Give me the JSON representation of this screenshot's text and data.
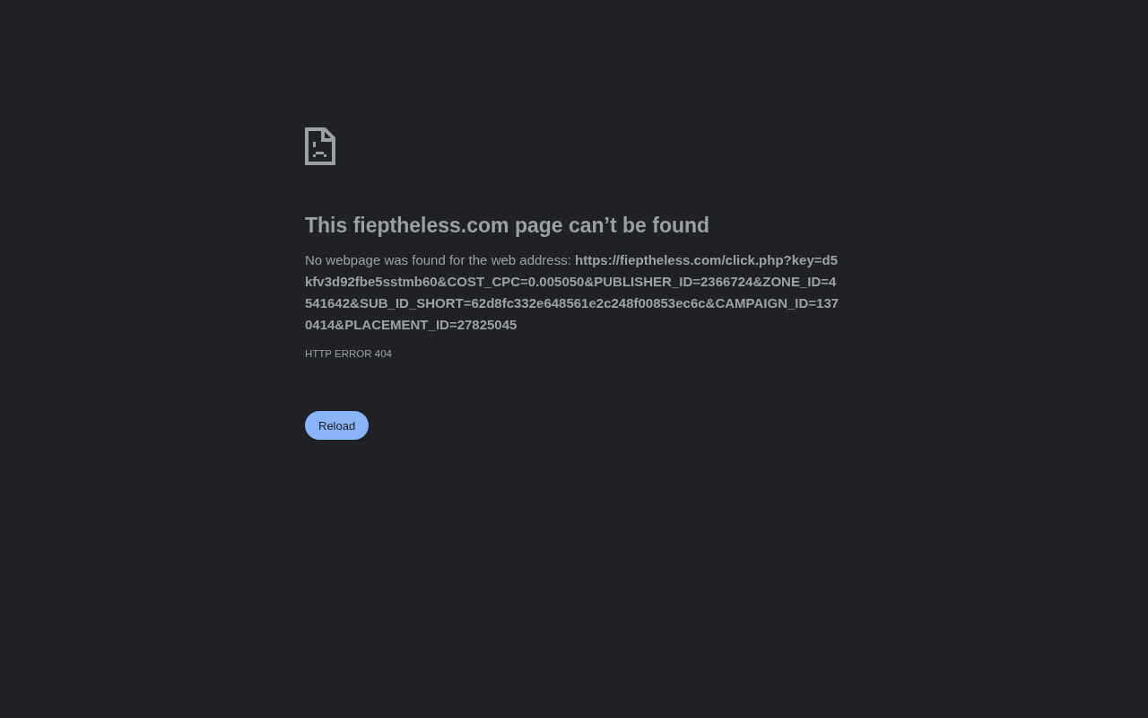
{
  "heading": "This fieptheless.com page can’t be found",
  "description": "No webpage was found for the web address: **https://fieptheless.com/click.php?key=d5kfv3d92fbe5sstmb60&COST_CPC=0.005050&PUBLISHER_ID=2366724&ZONE_ID=4541642&SUB_ID_SHORT=62d8fc332e648561e2c248f00853ec6c&CAMPAIGN_ID=1370414&PLACEMENT_ID=27825045**",
  "error_code": "HTTP ERROR 404",
  "buttons": [
    "Reload"
  ]
}
